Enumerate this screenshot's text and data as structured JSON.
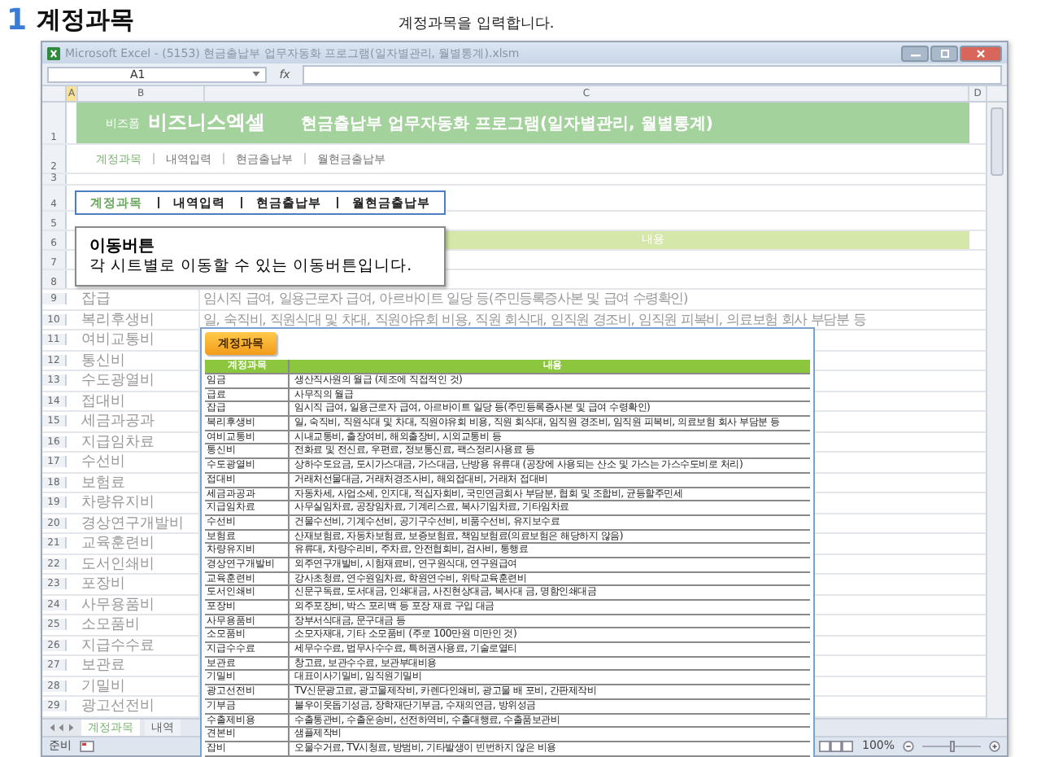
{
  "heading": {
    "number": "1",
    "title": "계정과목",
    "caption": "계정과목을 입력합니다."
  },
  "window": {
    "title": "Microsoft Excel - (5153) 현금출납부 업무자동화 프로그램(일자별관리, 월별통계).xlsm",
    "name_box": "A1",
    "formula_label": "fx"
  },
  "columns": [
    "A",
    "B",
    "C",
    "D"
  ],
  "banner": {
    "row": "1",
    "brand_small": "비즈폼",
    "brand": "비즈니스엑셀",
    "title": "현금출납부 업무자동화 프로그램(일자별관리, 월별통계)"
  },
  "nav": {
    "row": "2",
    "items": [
      {
        "label": "계정과목",
        "selected": true
      },
      {
        "label": "내역입력",
        "selected": false
      },
      {
        "label": "현금출납부",
        "selected": false
      },
      {
        "label": "월현금출납부",
        "selected": false
      }
    ]
  },
  "empty_rows": [
    "3",
    "4",
    "5"
  ],
  "callout_nav": [
    {
      "label": "계정과목",
      "selected": true
    },
    {
      "label": "내역입력",
      "selected": false
    },
    {
      "label": "현금출납부",
      "selected": false
    },
    {
      "label": "월현금출납부",
      "selected": false
    }
  ],
  "tooltip": {
    "title": "이동버튼",
    "text": "각 시트별로 이동할 수 있는 이동버튼입니다."
  },
  "sheet": {
    "header_row": "6",
    "header": "내용",
    "hidden_rows": [
      "7",
      "8"
    ],
    "rows": [
      {
        "row": "9",
        "account": "잡급",
        "content": "임시직 급여, 일용근로자 급여, 아르바이트 일당 등(주민등록증사본 및 급여 수령확인)"
      },
      {
        "row": "10",
        "account": "복리후생비",
        "content": "일, 숙직비, 직원식대 및 차대, 직원야유회 비용, 직원 회식대, 임직원 경조비, 임직원 피복비, 의료보험 회사 부담분 등"
      },
      {
        "row": "11",
        "account": "여비교통비"
      },
      {
        "row": "12",
        "account": "통신비"
      },
      {
        "row": "13",
        "account": "수도광열비"
      },
      {
        "row": "14",
        "account": "접대비"
      },
      {
        "row": "15",
        "account": "세금과공과"
      },
      {
        "row": "16",
        "account": "지급임차료"
      },
      {
        "row": "17",
        "account": "수선비"
      },
      {
        "row": "18",
        "account": "보험료"
      },
      {
        "row": "19",
        "account": "차량유지비"
      },
      {
        "row": "20",
        "account": "경상연구개발비"
      },
      {
        "row": "21",
        "account": "교육훈련비"
      },
      {
        "row": "22",
        "account": "도서인쇄비"
      },
      {
        "row": "23",
        "account": "포장비"
      },
      {
        "row": "24",
        "account": "사무용품비"
      },
      {
        "row": "25",
        "account": "소모품비"
      },
      {
        "row": "26",
        "account": "지급수수료"
      },
      {
        "row": "27",
        "account": "보관료"
      },
      {
        "row": "28",
        "account": "기밀비"
      },
      {
        "row": "29",
        "account": "광고선전비"
      }
    ]
  },
  "inset": {
    "button": "계정과목",
    "columns": [
      "계정과목",
      "내용"
    ],
    "rows": [
      {
        "account": "임금",
        "content": "생산직사원의 월급 (제조에 직접적인 것)"
      },
      {
        "account": "급료",
        "content": "사무직의 월급"
      },
      {
        "account": "잡급",
        "content": "임시직 급여, 일용근로자 급여, 아르바이트 일당 등(주민등록증사본 및 급여 수령확인)"
      },
      {
        "account": "복리후생비",
        "content": "일, 숙직비, 직원식대 및 차대, 직원야유회 비용, 직원 회식대, 임직원 경조비, 임직원 피복비, 의료보험 회사 부담분 등"
      },
      {
        "account": "여비교통비",
        "content": "시내교통비, 출장여비, 해외출장비, 시외교통비 등"
      },
      {
        "account": "통신비",
        "content": "전화료 및 전신료, 우편료, 정보통신료, 팩스정리사용료 등"
      },
      {
        "account": "수도광열비",
        "content": "상하수도요금, 도시가스대금, 가스대금, 난방용 유류대 (공장에 사용되는 산소 및 가스는 가스수도비로 처리)"
      },
      {
        "account": "접대비",
        "content": "거래처선물대금, 거래처경조사비, 해외접대비, 거래처 접대비"
      },
      {
        "account": "세금과공과",
        "content": "자동차세, 사업소세, 인지대, 적십자회비, 국민연금회사 부담분, 협회 및 조합비, 균등할주민세"
      },
      {
        "account": "지급임차료",
        "content": "사무실임차료, 공장임차료, 기계리스료, 복사기임차료, 기타임차료"
      },
      {
        "account": "수선비",
        "content": "건물수선비, 기계수선비, 공기구수선비, 비품수선비, 유지보수료"
      },
      {
        "account": "보험료",
        "content": "산재보험료, 자동차보험료, 보증보험료, 책임보험료(의료보험은 해당하지 않음)"
      },
      {
        "account": "차량유지비",
        "content": "유류대, 차량수리비, 주차료, 안전협회비, 검사비, 통행료"
      },
      {
        "account": "경상연구개발비",
        "content": "외주연구개발비, 시험재료비, 연구원식대, 연구원급여"
      },
      {
        "account": "교육훈련비",
        "content": "강사초청료, 연수원임차료, 학원연수비, 위탁교육훈련비"
      },
      {
        "account": "도서인쇄비",
        "content": "신문구독료, 도서대금, 인쇄대금, 사진현상대금, 복사대 금, 명함인쇄대금"
      },
      {
        "account": "포장비",
        "content": "외주포장비, 박스 포리백 등 포장 재료 구입 대금"
      },
      {
        "account": "사무용품비",
        "content": "장부서식대금, 문구대금 등"
      },
      {
        "account": "소모품비",
        "content": "소모자재대, 기타 소모품비 (주로 100만원 미만인 것)"
      },
      {
        "account": "지급수수료",
        "content": "세무수수료, 법무사수수료, 특허권사용료, 기술로열티"
      },
      {
        "account": "보관료",
        "content": "창고료, 보관수수료, 보관부대비용"
      },
      {
        "account": "기밀비",
        "content": "대표이사기밀비, 임직원기밀비"
      },
      {
        "account": "광고선전비",
        "content": "TV신문광고료, 광고물제작비, 카렌다인쇄비, 광고물 배 포비, 간판제작비"
      },
      {
        "account": "기부금",
        "content": "불우이웃돕기성금, 장학재단기부금, 수재의연금, 방위성금"
      },
      {
        "account": "수출제비용",
        "content": "수출통관비, 수출운송비, 선전하역비, 수출대행료, 수출품보관비"
      },
      {
        "account": "견본비",
        "content": "샘플제작비"
      },
      {
        "account": "잡비",
        "content": "오물수거료, TV시청료, 방범비, 기타발생이 빈번하지 않은 비용"
      }
    ]
  },
  "sheet_tabs": [
    {
      "label": "계정과목",
      "selected": true
    },
    {
      "label": "내역",
      "selected": false
    }
  ],
  "status": {
    "text": "준비",
    "zoom": "100%",
    "zoom_slider": {
      "level": 0.5
    }
  }
}
